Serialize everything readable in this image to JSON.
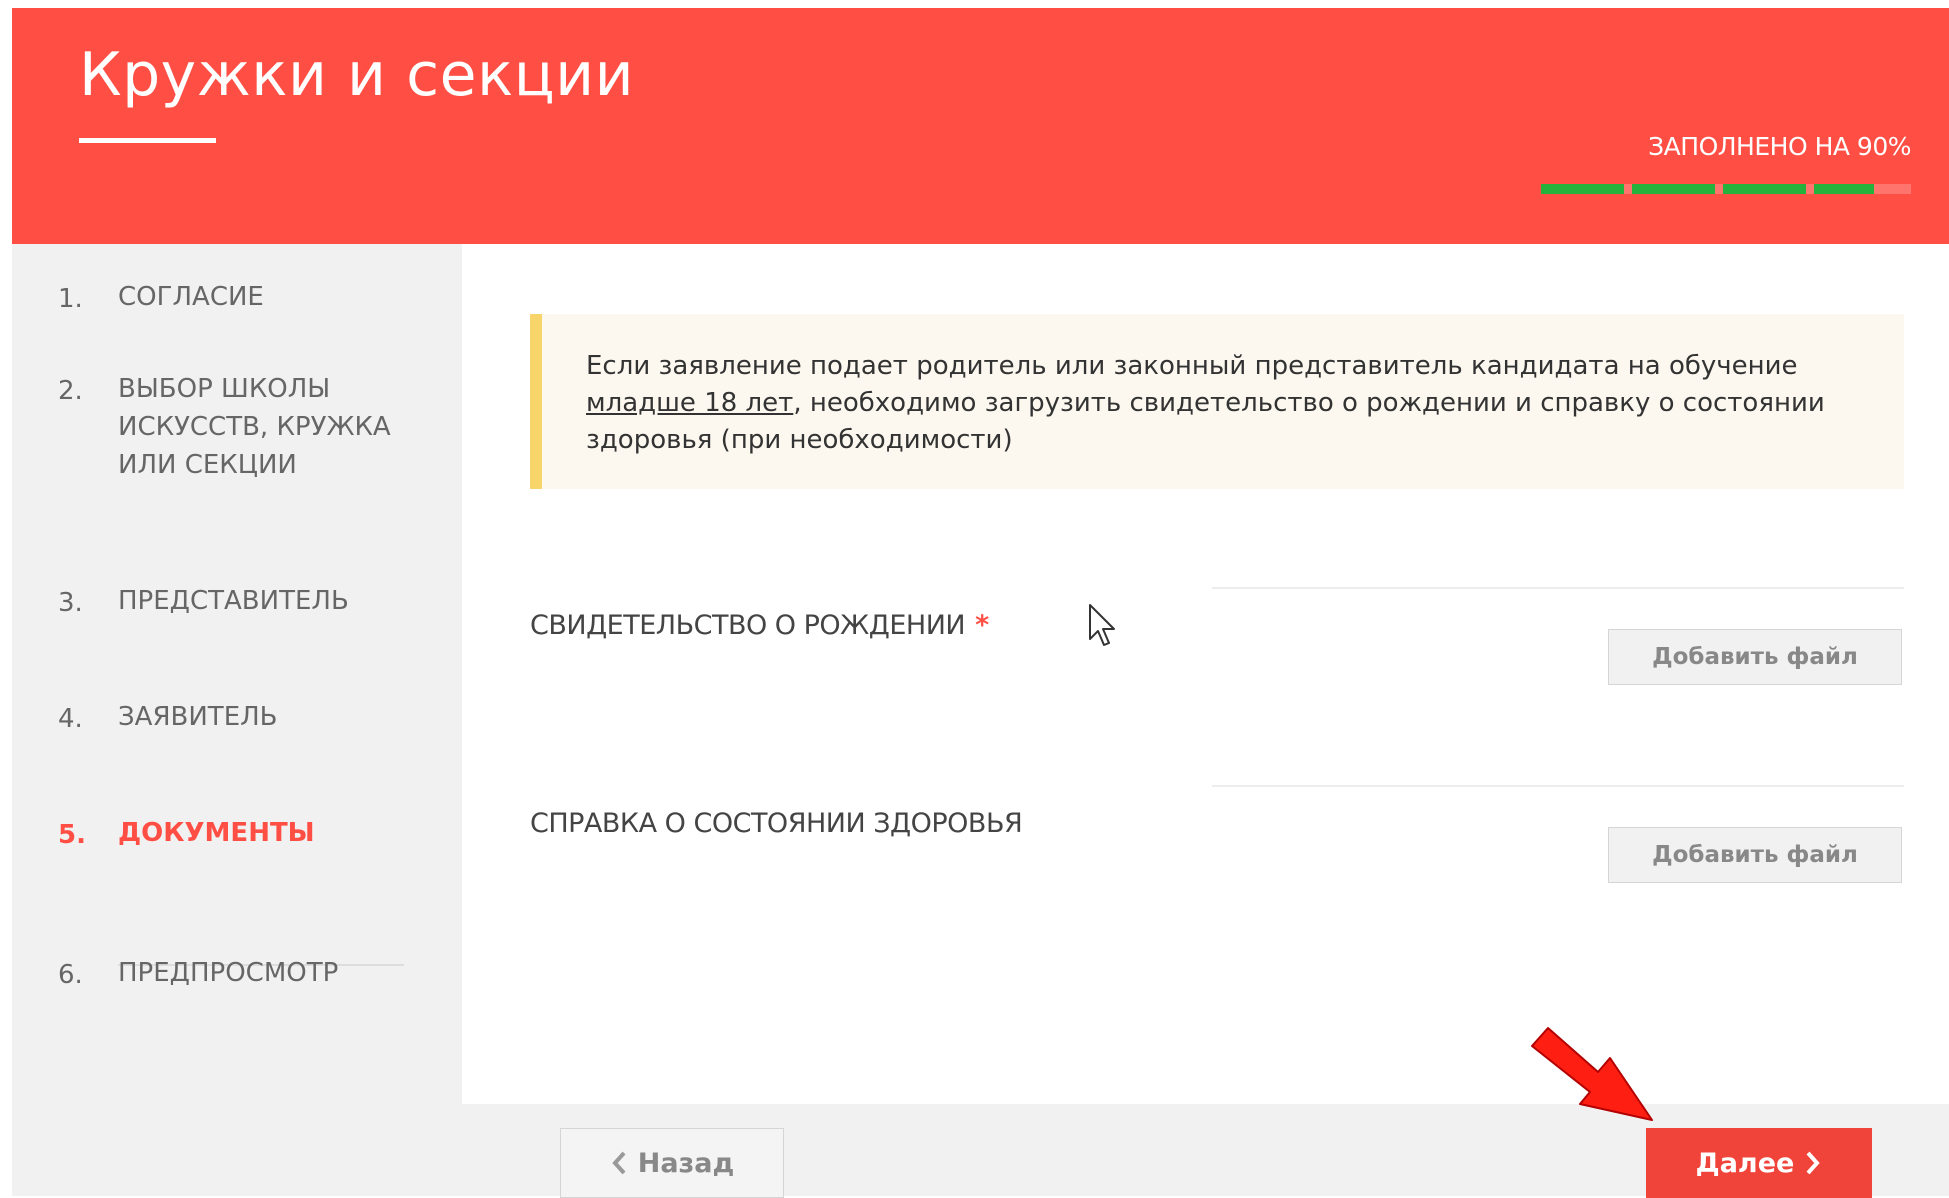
{
  "header": {
    "title": "Кружки и секции",
    "progress_label": "ЗАПОЛНЕНО НА 90%",
    "progress_fraction": 0.9,
    "progress_color": "#24b23c"
  },
  "sidebar": {
    "steps": [
      {
        "num": "1.",
        "label": "СОГЛАСИЕ",
        "active": false
      },
      {
        "num": "2.",
        "label": "ВЫБОР ШКОЛЫ ИСКУССТВ, КРУЖКА ИЛИ СЕКЦИИ",
        "active": false
      },
      {
        "num": "3.",
        "label": "ПРЕДСТАВИТЕЛЬ",
        "active": false
      },
      {
        "num": "4.",
        "label": "ЗАЯВИТЕЛЬ",
        "active": false
      },
      {
        "num": "5.",
        "label": "ДОКУМЕНТЫ",
        "active": true
      },
      {
        "num": "6.",
        "label": "ПРЕДПРОСМОТР",
        "active": false
      }
    ]
  },
  "notice": {
    "text_before": "Если заявление подает родитель или законный представитель кандидата на обучение ",
    "underlined": "младше 18 лет",
    "text_after": ", необходимо загрузить свидетельство о рождении и справку о состоянии здоровья (при необходимости)"
  },
  "documents": [
    {
      "label": "СВИДЕТЕЛЬСТВО О РОЖДЕНИИ",
      "required_mark": "*",
      "button_label": "Добавить файл"
    },
    {
      "label": "СПРАВКА О СОСТОЯНИИ ЗДОРОВЬЯ",
      "button_label": "Добавить файл"
    }
  ],
  "footer": {
    "back_label": "Назад",
    "next_label": "Далее"
  },
  "colors": {
    "brand": "#ff4f45",
    "notice_accent": "#f8d56b"
  },
  "icons": [
    "chevron-left-icon",
    "chevron-right-icon",
    "mouse-cursor-icon",
    "red-arrow-annotation"
  ]
}
